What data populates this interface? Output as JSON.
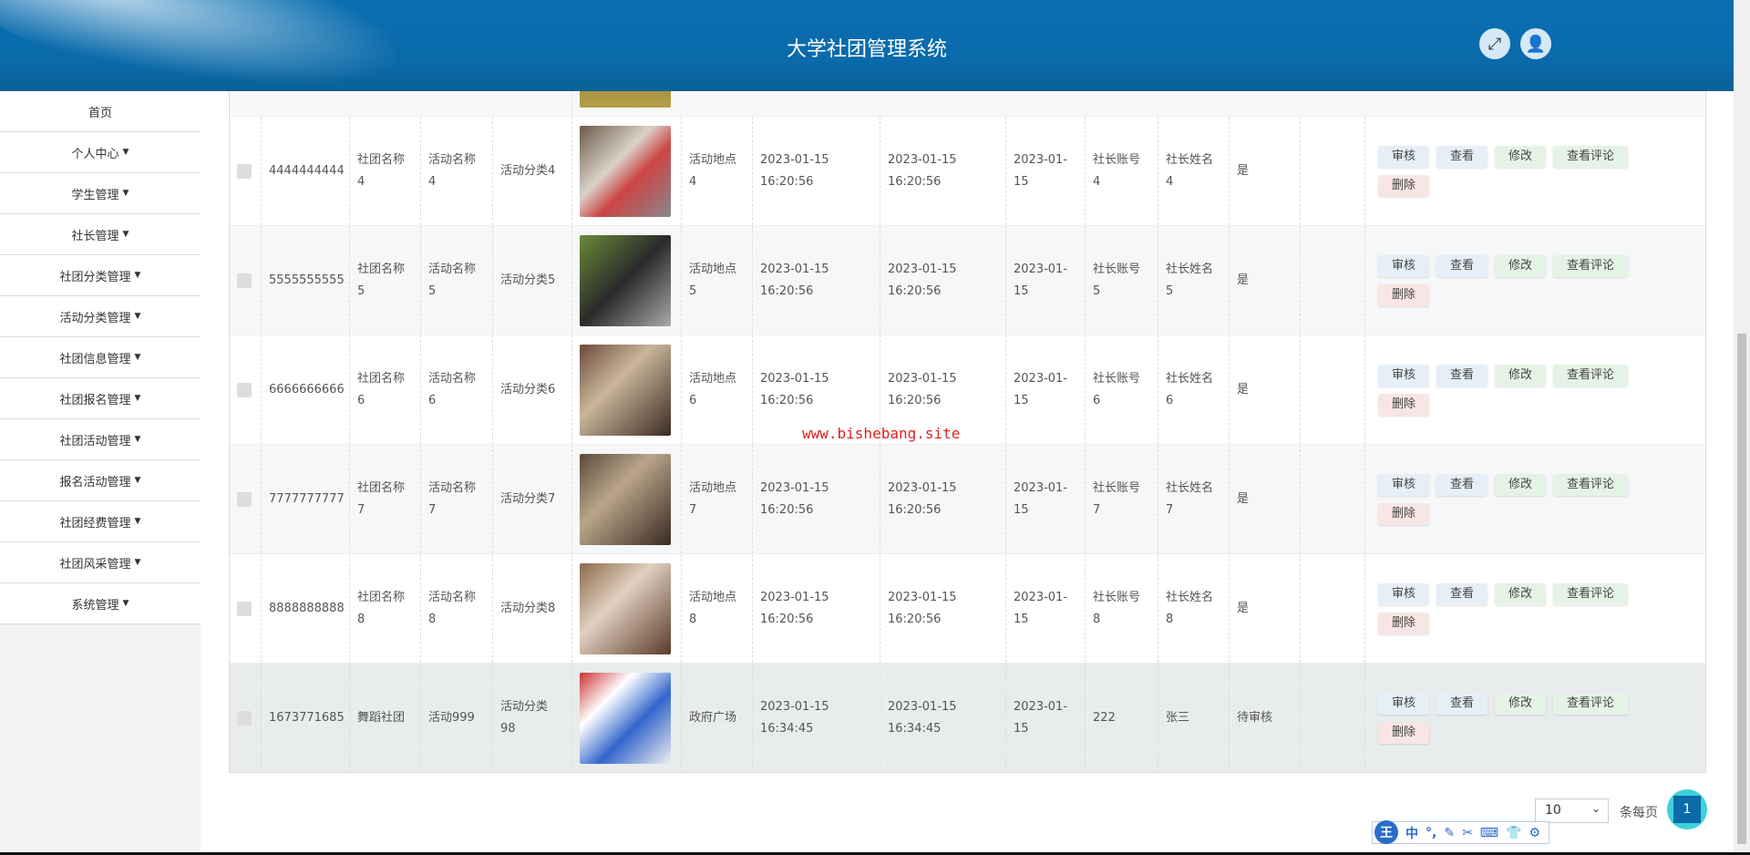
{
  "header": {
    "title": "大学社团管理系统",
    "fullscreen_icon": "expand-icon",
    "user_icon": "user-icon"
  },
  "sidebar": {
    "items": [
      {
        "label": "首页",
        "caret": false
      },
      {
        "label": "个人中心",
        "caret": true
      },
      {
        "label": "学生管理",
        "caret": true
      },
      {
        "label": "社长管理",
        "caret": true
      },
      {
        "label": "社团分类管理",
        "caret": true
      },
      {
        "label": "活动分类管理",
        "caret": true
      },
      {
        "label": "社团信息管理",
        "caret": true
      },
      {
        "label": "社团报名管理",
        "caret": true
      },
      {
        "label": "社团活动管理",
        "caret": true
      },
      {
        "label": "报名活动管理",
        "caret": true
      },
      {
        "label": "社团经费管理",
        "caret": true
      },
      {
        "label": "社团风采管理",
        "caret": true
      },
      {
        "label": "系统管理",
        "caret": true
      }
    ]
  },
  "table": {
    "actions": {
      "review": "审核",
      "view": "查看",
      "edit": "修改",
      "comments": "查看评论",
      "delete": "删除"
    },
    "rows": [
      {
        "id": "4444444444",
        "club": "社团名称\n4",
        "activity": "活动名称\n4",
        "category": "活动分类4",
        "location": "活动地点\n4",
        "start": "2023-01-15\n16:20:56",
        "end": "2023-01-15\n16:20:56",
        "date": "2023-01-\n15",
        "account": "社长账号\n4",
        "leader": "社长姓名\n4",
        "status": "是"
      },
      {
        "id": "5555555555",
        "club": "社团名称\n5",
        "activity": "活动名称\n5",
        "category": "活动分类5",
        "location": "活动地点\n5",
        "start": "2023-01-15\n16:20:56",
        "end": "2023-01-15\n16:20:56",
        "date": "2023-01-\n15",
        "account": "社长账号\n5",
        "leader": "社长姓名\n5",
        "status": "是"
      },
      {
        "id": "6666666666",
        "club": "社团名称\n6",
        "activity": "活动名称\n6",
        "category": "活动分类6",
        "location": "活动地点\n6",
        "start": "2023-01-15\n16:20:56",
        "end": "2023-01-15\n16:20:56",
        "date": "2023-01-\n15",
        "account": "社长账号\n6",
        "leader": "社长姓名\n6",
        "status": "是"
      },
      {
        "id": "7777777777",
        "club": "社团名称\n7",
        "activity": "活动名称\n7",
        "category": "活动分类7",
        "location": "活动地点\n7",
        "start": "2023-01-15\n16:20:56",
        "end": "2023-01-15\n16:20:56",
        "date": "2023-01-\n15",
        "account": "社长账号\n7",
        "leader": "社长姓名\n7",
        "status": "是"
      },
      {
        "id": "8888888888",
        "club": "社团名称\n8",
        "activity": "活动名称\n8",
        "category": "活动分类8",
        "location": "活动地点\n8",
        "start": "2023-01-15\n16:20:56",
        "end": "2023-01-15\n16:20:56",
        "date": "2023-01-\n15",
        "account": "社长账号\n8",
        "leader": "社长姓名\n8",
        "status": "是"
      },
      {
        "id": "1673771685",
        "club": "舞蹈社团",
        "activity": "活动999",
        "category": "活动分类\n98",
        "location": "政府广场",
        "start": "2023-01-15\n16:34:45",
        "end": "2023-01-15\n16:34:45",
        "date": "2023-01-\n15",
        "account": "222",
        "leader": "张三",
        "status": "待审核"
      }
    ]
  },
  "watermark": "www.bishebang.site",
  "pagination": {
    "page_size": "10",
    "per_page_label": "条每页",
    "current_page": "1"
  },
  "ime_toolbar": {
    "logo": "王",
    "mode": "中",
    "icons": [
      "punctuation-icon",
      "pen-icon",
      "scissors-icon",
      "keyboard-icon",
      "shirt-icon",
      "gear-icon"
    ]
  }
}
